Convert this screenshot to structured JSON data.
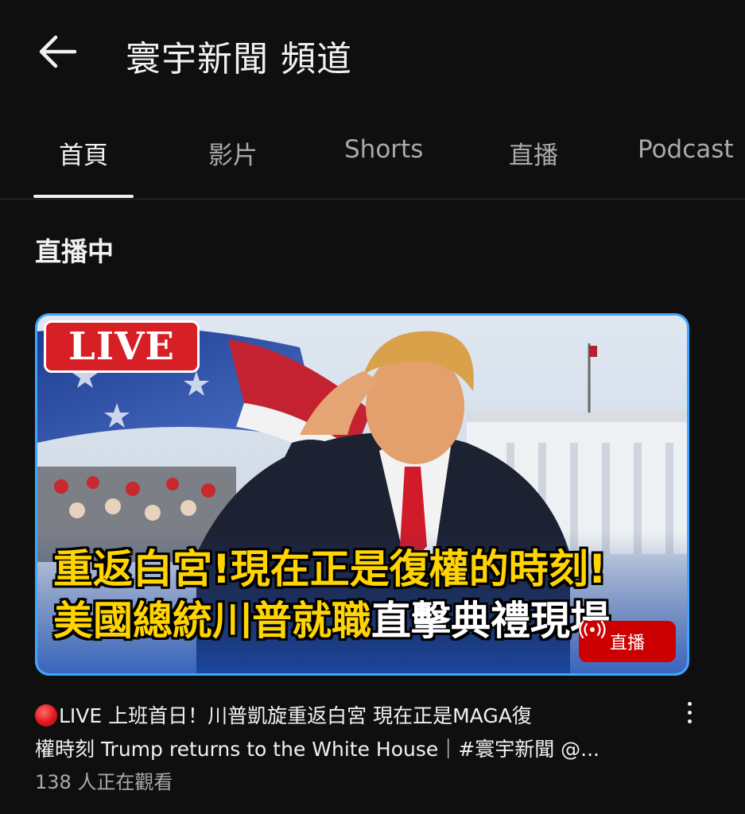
{
  "header": {
    "back_icon": "arrow-left-icon",
    "title": "寰宇新聞 頻道"
  },
  "tabs": [
    {
      "label": "首頁",
      "active": true
    },
    {
      "label": "影片",
      "active": false
    },
    {
      "label": "Shorts",
      "active": false
    },
    {
      "label": "直播",
      "active": false
    },
    {
      "label": "Podcast",
      "active": false
    }
  ],
  "section": {
    "title": "直播中"
  },
  "video": {
    "thumbnail": {
      "live_tag": "LIVE",
      "headline_line1": "重返白宮!現在正是復權的時刻!",
      "headline_line2_yellow": "美國總統川普就職",
      "headline_line2_white": "直擊典禮現場",
      "badge_label": "直播",
      "badge_icon": "broadcast-icon"
    },
    "title_line1": "LIVE 上班首日！川普凱旋重返白宮 現在正是MAGA復",
    "title_line2": "權時刻 Trump returns to the White House｜#寰宇新聞 @...",
    "viewers": "138 人正在觀看",
    "menu_icon": "more-vert-icon"
  },
  "colors": {
    "background": "#0f0f0f",
    "text_primary": "#f1f1f1",
    "text_secondary": "#aaaaaa",
    "accent_border": "#3ea6ff",
    "live_red": "#cc0000"
  }
}
